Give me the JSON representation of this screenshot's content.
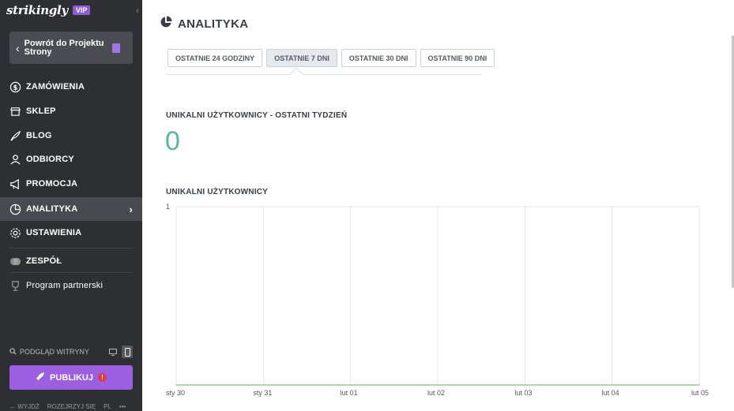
{
  "sidebar": {
    "logo": "strikingly",
    "badge": "VIP",
    "back_label": "Powrót do Projektu Strony",
    "items": [
      {
        "label": "ZAMÓWIENIA",
        "icon": "dollar-circle-icon"
      },
      {
        "label": "SKLEP",
        "icon": "store-icon"
      },
      {
        "label": "BLOG",
        "icon": "quill-icon"
      },
      {
        "label": "ODBIORCY",
        "icon": "people-icon"
      },
      {
        "label": "PROMOCJA",
        "icon": "megaphone-icon"
      },
      {
        "label": "ANALITYKA",
        "icon": "pie-chart-icon"
      },
      {
        "label": "USTAWIENIA",
        "icon": "gear-icon"
      },
      {
        "label": "ZESPÓŁ",
        "icon": "team-icon"
      },
      {
        "label": "Program partnerski",
        "icon": "trophy-icon"
      }
    ],
    "preview_label": "PODGLĄD WITRYNY",
    "publish_label": "PUBLIKUJ",
    "footer": [
      "← WYJDŹ",
      "ROZEJRZYJ SIĘ",
      "PL",
      "•••"
    ]
  },
  "main": {
    "title": "ANALITYKA",
    "tabs": [
      "OSTATNIE 24 GODZINY",
      "OSTATNIE 7 DNI",
      "OSTATNIE 30 DNI",
      "OSTATNIE 90 DNI"
    ],
    "active_tab": 1,
    "stat_label": "UNIKALNI UŻYTKOWNICY - OSTATNI TYDZIEŃ",
    "stat_value": "0",
    "chart_title": "UNIKALNI UŻYTKOWNICY"
  },
  "colors": {
    "sidebar_bg": "#2e2f33",
    "accent_purple": "#9d5fe1",
    "stat_teal": "#55b8a4",
    "line_green": "#8fd38a"
  },
  "chart_data": {
    "type": "line",
    "title": "UNIKALNI UŻYTKOWNICY",
    "categories": [
      "sty 30",
      "sty 31",
      "lut 01",
      "lut 02",
      "lut 03",
      "lut 04",
      "lut 05"
    ],
    "series": [
      {
        "values": [
          0,
          0,
          0,
          0,
          0,
          0,
          0
        ]
      }
    ],
    "yticks": [
      "1"
    ],
    "ylim": [
      0,
      1
    ],
    "grid": "vertical"
  }
}
